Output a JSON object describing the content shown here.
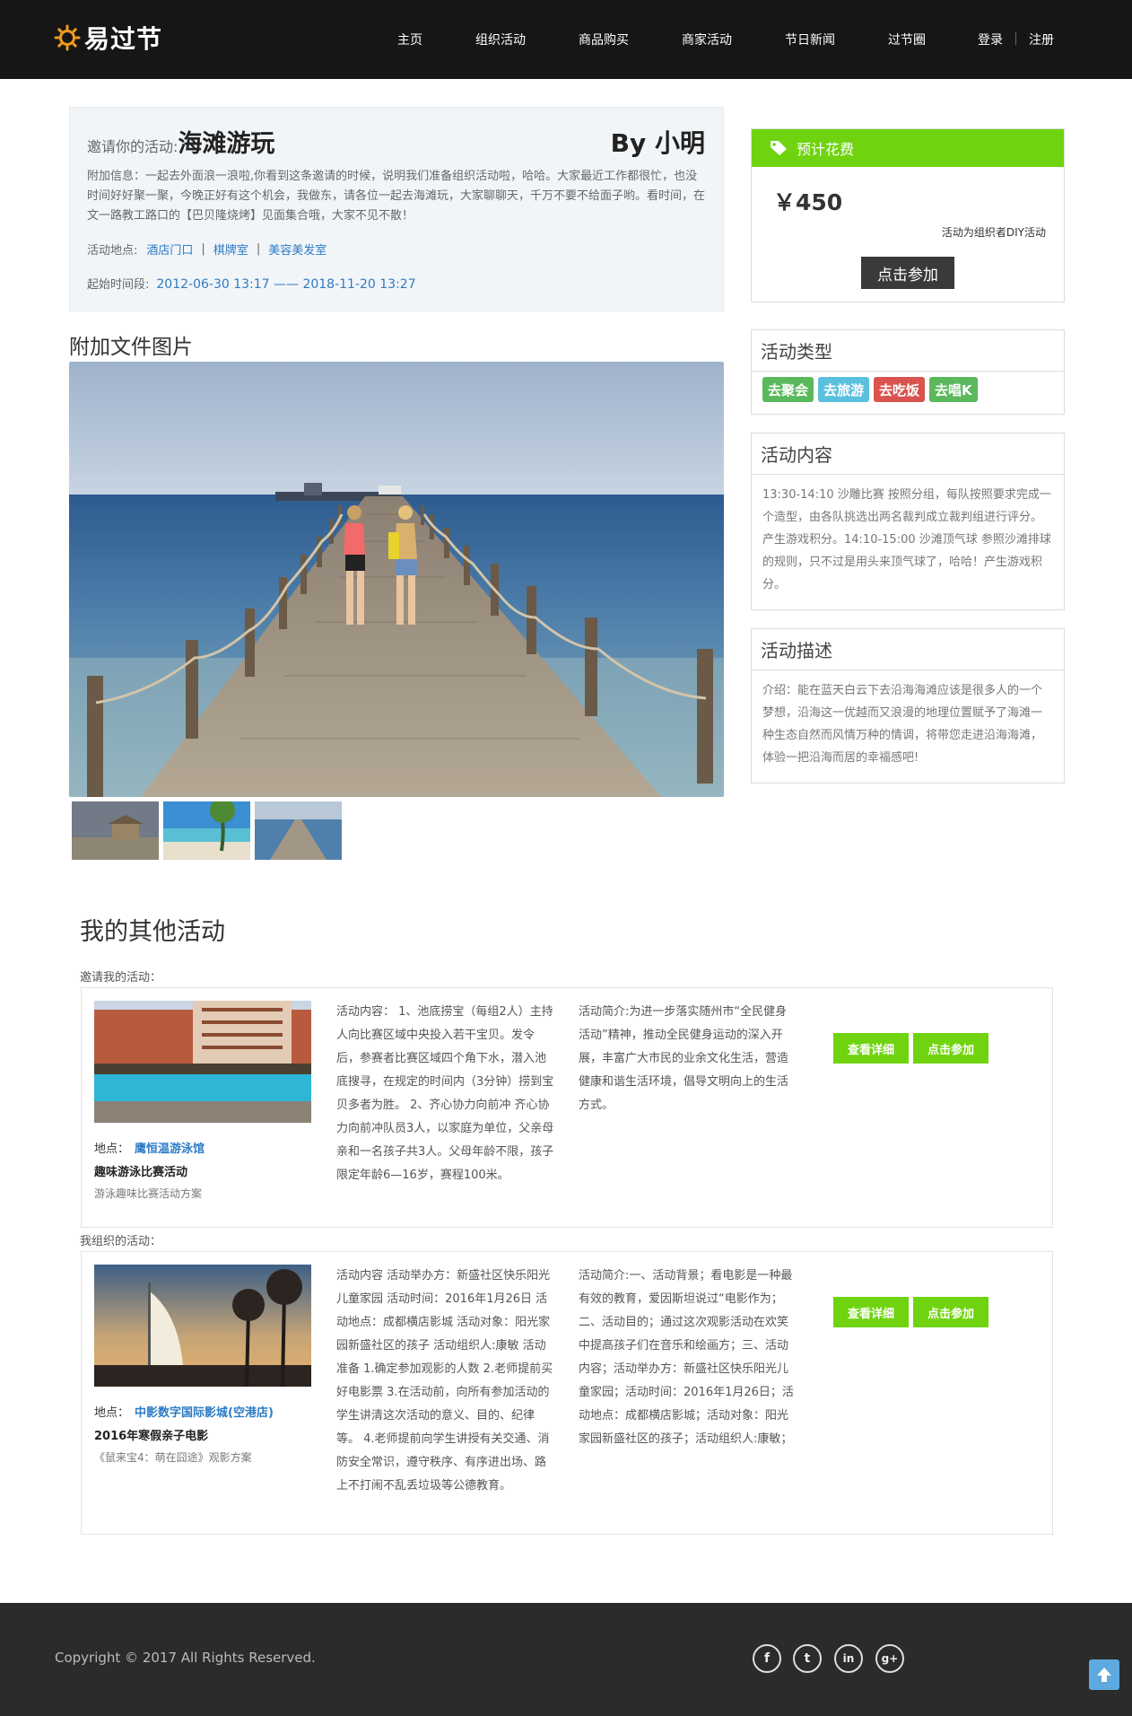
{
  "header": {
    "logo_text": "易过节",
    "nav": [
      "主页",
      "组织活动",
      "商品购买",
      "商家活动",
      "节日新闻",
      "过节圈"
    ],
    "login": "登录",
    "register": "注册"
  },
  "invitation": {
    "prefix": "邀请你的活动:",
    "title": "海滩游玩",
    "by": "By 小明",
    "description": "附加信息：一起去外面浪一浪啦,你看到这条邀请的时候，说明我们准备组织活动啦，哈哈。大家最近工作都很忙，也没时间好好聚一聚，今晚正好有这个机会，我做东，请各位一起去海滩玩，大家聊聊天，千万不要不给面子哟。看时间，在文一路教工路口的【巴贝隆烧烤】见面集合哦，大家不见不散！",
    "location_label": "活动地点:",
    "locations": [
      "酒店门口",
      "棋牌室",
      "美容美发室"
    ],
    "time_label": "起始时间段:",
    "time_value": "2012-06-30 13:17 —— 2018-11-20 13:27"
  },
  "attachments": {
    "title": "附加文件图片",
    "main_image": "pier-beach-photo",
    "thumbs": [
      "beach-hut-thumb",
      "tropical-beach-thumb",
      "pier-thumb"
    ]
  },
  "cost": {
    "header": "预计花费",
    "icon": "tag-icon",
    "amount": "￥450",
    "note": "活动为组织者DIY活动",
    "join_label": "点击参加"
  },
  "types": {
    "title": "活动类型",
    "tags": [
      {
        "label": "去聚会",
        "color": "#5cb85c"
      },
      {
        "label": "去旅游",
        "color": "#5bc0de"
      },
      {
        "label": "去吃饭",
        "color": "#d9534f"
      },
      {
        "label": "去唱K",
        "color": "#5cb85c"
      }
    ]
  },
  "content": {
    "title": "活动内容",
    "text": "13:30-14:10 沙雕比赛 按照分组，每队按照要求完成一个造型，由各队挑选出两名裁判成立裁判组进行评分。产生游戏积分。14:10-15:00 沙滩顶气球 参照沙滩排球的规则，只不过是用头来顶气球了，哈哈！产生游戏积分。"
  },
  "description": {
    "title": "活动描述",
    "text": "介绍：能在蓝天白云下去沿海海滩应该是很多人的一个梦想，沿海这一优越而又浪漫的地理位置赋予了海滩一种生态自然而风情万种的情调，将带您走进沿海海滩，体验一把沿海而居的幸福感吧!"
  },
  "other": {
    "title": "我的其他活动",
    "invited_label": "邀请我的活动：",
    "organized_label": "我组织的活动：",
    "activities": [
      {
        "image": "resort-pool-photo",
        "loc_label": "地点：",
        "loc": "鹰恒温游泳馆",
        "name": "趣味游泳比赛活动",
        "sub": "游泳趣味比赛活动方案",
        "content": "活动内容： 1、池底捞宝（每组2人）主持人向比赛区域中央投入若干宝贝。发令后，参赛者比赛区域四个角下水，潜入池底搜寻，在规定的时间内（3分钟）捞到宝贝多者为胜。 2、齐心协力向前冲 齐心协力向前冲队员3人，以家庭为单位，父亲母亲和一名孩子共3人。父母年龄不限，孩子限定年龄6—16岁，赛程100米。",
        "intro": "活动简介:为进一步落实随州市“全民健身活动”精神，推动全民健身运动的深入开展，丰富广大市民的业余文化生活，营造健康和谐生活环境，倡导文明向上的生活方式。",
        "detail_label": "查看详细",
        "join_label": "点击参加"
      },
      {
        "image": "burj-al-arab-photo",
        "loc_label": "地点：",
        "loc": "中影数字国际影城(空港店)",
        "name": "2016年寒假亲子电影",
        "sub": "《鼠来宝4：萌在囧途》观影方案",
        "content": "活动内容 活动举办方：新盛社区快乐阳光儿童家园 活动时间：2016年1月26日 活动地点：成都横店影城 活动对象：阳光家园新盛社区的孩子 活动组织人:康敏 活动准备 1.确定参加观影的人数 2.老师提前买好电影票 3.在活动前，向所有参加活动的学生讲清这次活动的意义、目的、纪律等。 4.老师提前向学生讲授有关交通、消防安全常识，遵守秩序、有序进出场、路上不打闹不乱丢垃圾等公德教育。",
        "intro": "活动简介:一、活动背景；看电影是一种最有效的教育，爱因斯坦说过“电影作为；二、活动目的；通过这次观影活动在欢笑中提高孩子们在音乐和绘画方；三、活动内容；活动举办方：新盛社区快乐阳光儿童家园；活动时间：2016年1月26日；活动地点：成都横店影城；活动对象：阳光家园新盛社区的孩子；活动组织人:康敏；",
        "detail_label": "查看详细",
        "join_label": "点击参加"
      }
    ]
  },
  "footer": {
    "copyright": "Copyright © 2017 All Rights Reserved.",
    "social": [
      "f",
      "t",
      "in",
      "g+"
    ]
  }
}
